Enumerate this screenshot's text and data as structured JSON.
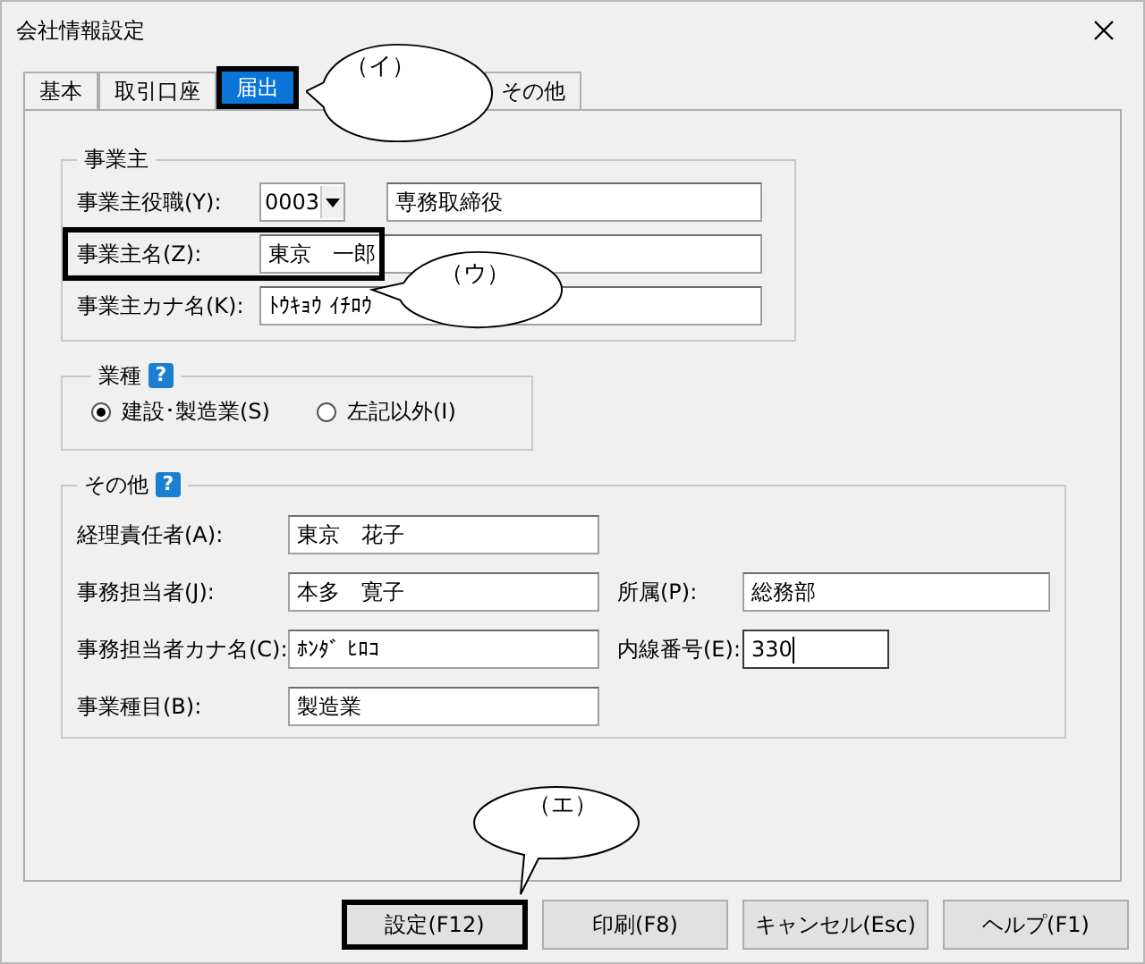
{
  "window": {
    "title": "会社情報設定"
  },
  "tabs": [
    {
      "label": "基本",
      "selected": false,
      "highlighted": false
    },
    {
      "label": "取引口座",
      "selected": false,
      "highlighted": false
    },
    {
      "label": "届出",
      "selected": true,
      "highlighted": true
    },
    {
      "label": "その他",
      "selected": false,
      "highlighted": false
    }
  ],
  "owner": {
    "title": "事業主",
    "fields": [
      {
        "kind": "combo",
        "label": "事業主役職(Y):",
        "code": "0003",
        "value": "専務取締役",
        "highlighted": false
      },
      {
        "kind": "text",
        "label": "事業主名(Z):",
        "value": "東京　一郎",
        "highlighted": true
      },
      {
        "kind": "text",
        "label": "事業主カナ名(K):",
        "value": "ﾄｳｷｮｳ ｲﾁﾛｳ",
        "highlighted": false
      }
    ]
  },
  "industry": {
    "title": "業種",
    "help": "?",
    "options": [
      {
        "label": "建設･製造業(S)",
        "selected": true
      },
      {
        "label": "左記以外(I)",
        "selected": false
      }
    ]
  },
  "other": {
    "title": "その他",
    "help": "?",
    "rows": [
      {
        "fields": [
          {
            "label": "経理責任者(A):",
            "value": "東京　花子",
            "focused": false
          }
        ]
      },
      {
        "fields": [
          {
            "label": "事務担当者(J):",
            "value": "本多　寛子",
            "focused": false
          },
          {
            "label": "所属(P):",
            "value": "総務部",
            "focused": false
          }
        ]
      },
      {
        "fields": [
          {
            "label": "事務担当者カナ名(C):",
            "value": "ﾎﾝﾀﾞ ﾋﾛｺ",
            "focused": false
          },
          {
            "label": "内線番号(E):",
            "value": "330",
            "focused": true
          }
        ]
      },
      {
        "fields": [
          {
            "label": "事業種目(B):",
            "value": "製造業",
            "focused": false
          }
        ]
      }
    ]
  },
  "buttons": [
    {
      "label": "設定(F12)",
      "highlighted": true
    },
    {
      "label": "印刷(F8)",
      "highlighted": false
    },
    {
      "label": "キャンセル(Esc)",
      "highlighted": false
    },
    {
      "label": "ヘルプ(F1)",
      "highlighted": false
    }
  ],
  "callouts": [
    {
      "label": "（イ）"
    },
    {
      "label": "（ウ）"
    },
    {
      "label": "（エ）"
    }
  ]
}
